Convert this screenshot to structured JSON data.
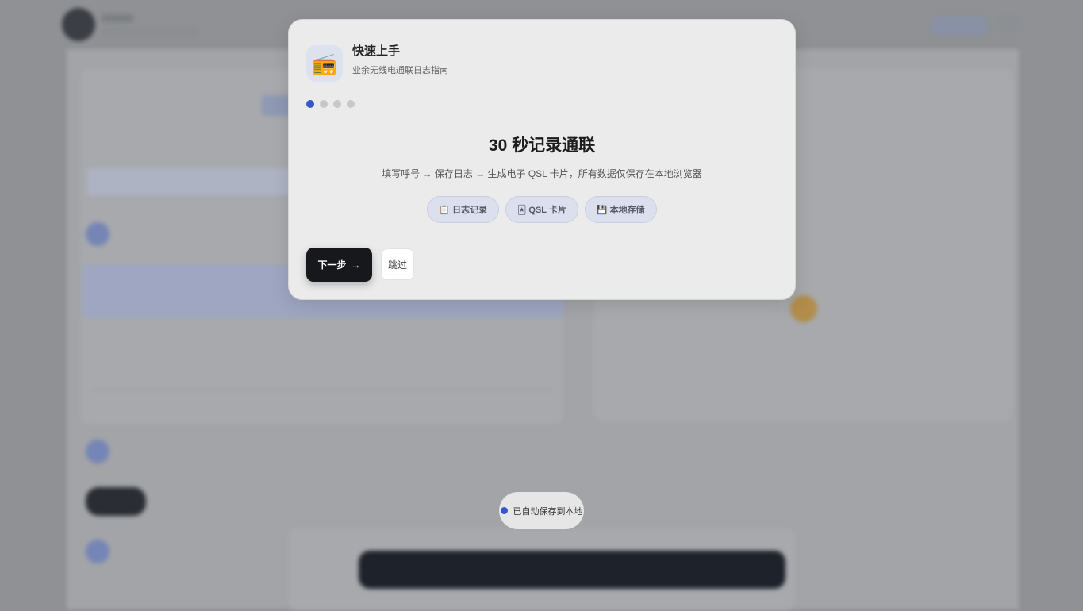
{
  "modal": {
    "icon": "radio-icon",
    "icon_glyph": "📻",
    "title": "快速上手",
    "subtitle": "业余无线电通联日志指南",
    "steps": {
      "total": 4,
      "current": 1
    },
    "headline": "30 秒记录通联",
    "description": "填写呼号 → 保存日志 → 生成电子 QSL 卡片，所有数据仅保存在本地浏览器",
    "chips": [
      {
        "icon": "clipboard-icon",
        "glyph": "📋",
        "label": "日志记录"
      },
      {
        "icon": "card-icon",
        "glyph": "🃏",
        "label": "QSL 卡片"
      },
      {
        "icon": "floppy-disk-icon",
        "glyph": "💾",
        "label": "本地存储"
      }
    ],
    "primary_label": "下一步",
    "primary_arrow": "→",
    "secondary_label": "跳过"
  },
  "toast": {
    "text": "已自动保存到本地"
  },
  "colors": {
    "accent": "#3557c9",
    "primary_button": "#16181c",
    "modal_bg": "#ebebeb"
  }
}
